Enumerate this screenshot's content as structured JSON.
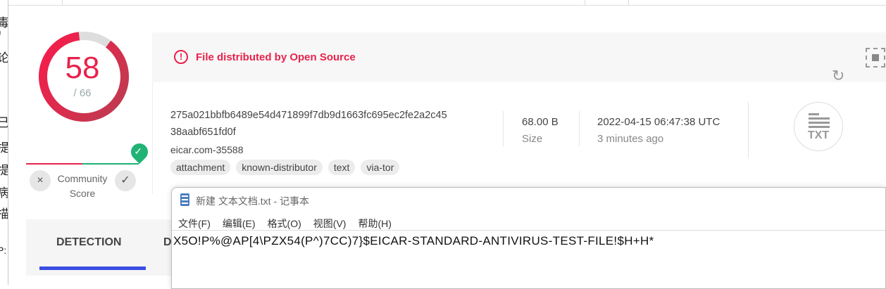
{
  "background_window": {
    "chars": [
      "毒",
      ")",
      "论",
      "己",
      "提",
      "提",
      "病",
      "描",
      "P:"
    ]
  },
  "score": {
    "detections": "58",
    "total": "/ 66",
    "fraction": 0.879
  },
  "community": {
    "label_line1": "Community",
    "label_line2": "Score",
    "downvote_icon": "×",
    "upvote_icon": "✓",
    "check_icon": "✓"
  },
  "tabs": {
    "detection": "DETECTION",
    "details_partial": "D"
  },
  "banner": {
    "icon": "!",
    "text": "File distributed by Open Source"
  },
  "file": {
    "hash_line1": "275a021bbfb6489e54d471899f7db9d1663fc695ec2fe2a2c45",
    "hash_line2": "38aabf651fd0f",
    "name": "eicar.com-35588",
    "tags": [
      "attachment",
      "known-distributor",
      "text",
      "via-tor"
    ],
    "size_value": "68.00 B",
    "size_label": "Size",
    "date_value": "2022-04-15 06:47:38 UTC",
    "date_label": "3 minutes ago",
    "type_label": "TXT"
  },
  "icons": {
    "refresh": "↻"
  },
  "notepad": {
    "title": "新建 文本文档.txt - 记事本",
    "menu": [
      "文件(F)",
      "编辑(E)",
      "格式(O)",
      "视图(V)",
      "帮助(H)"
    ],
    "content": "X5O!P%@AP[4\\PZX54(P^)7CC)7}$EICAR-STANDARD-ANTIVIRUS-TEST-FILE!$H+H*"
  },
  "colors": {
    "malicious": "#e8224c",
    "harmless": "#20b374",
    "accent": "#3a4de0"
  }
}
